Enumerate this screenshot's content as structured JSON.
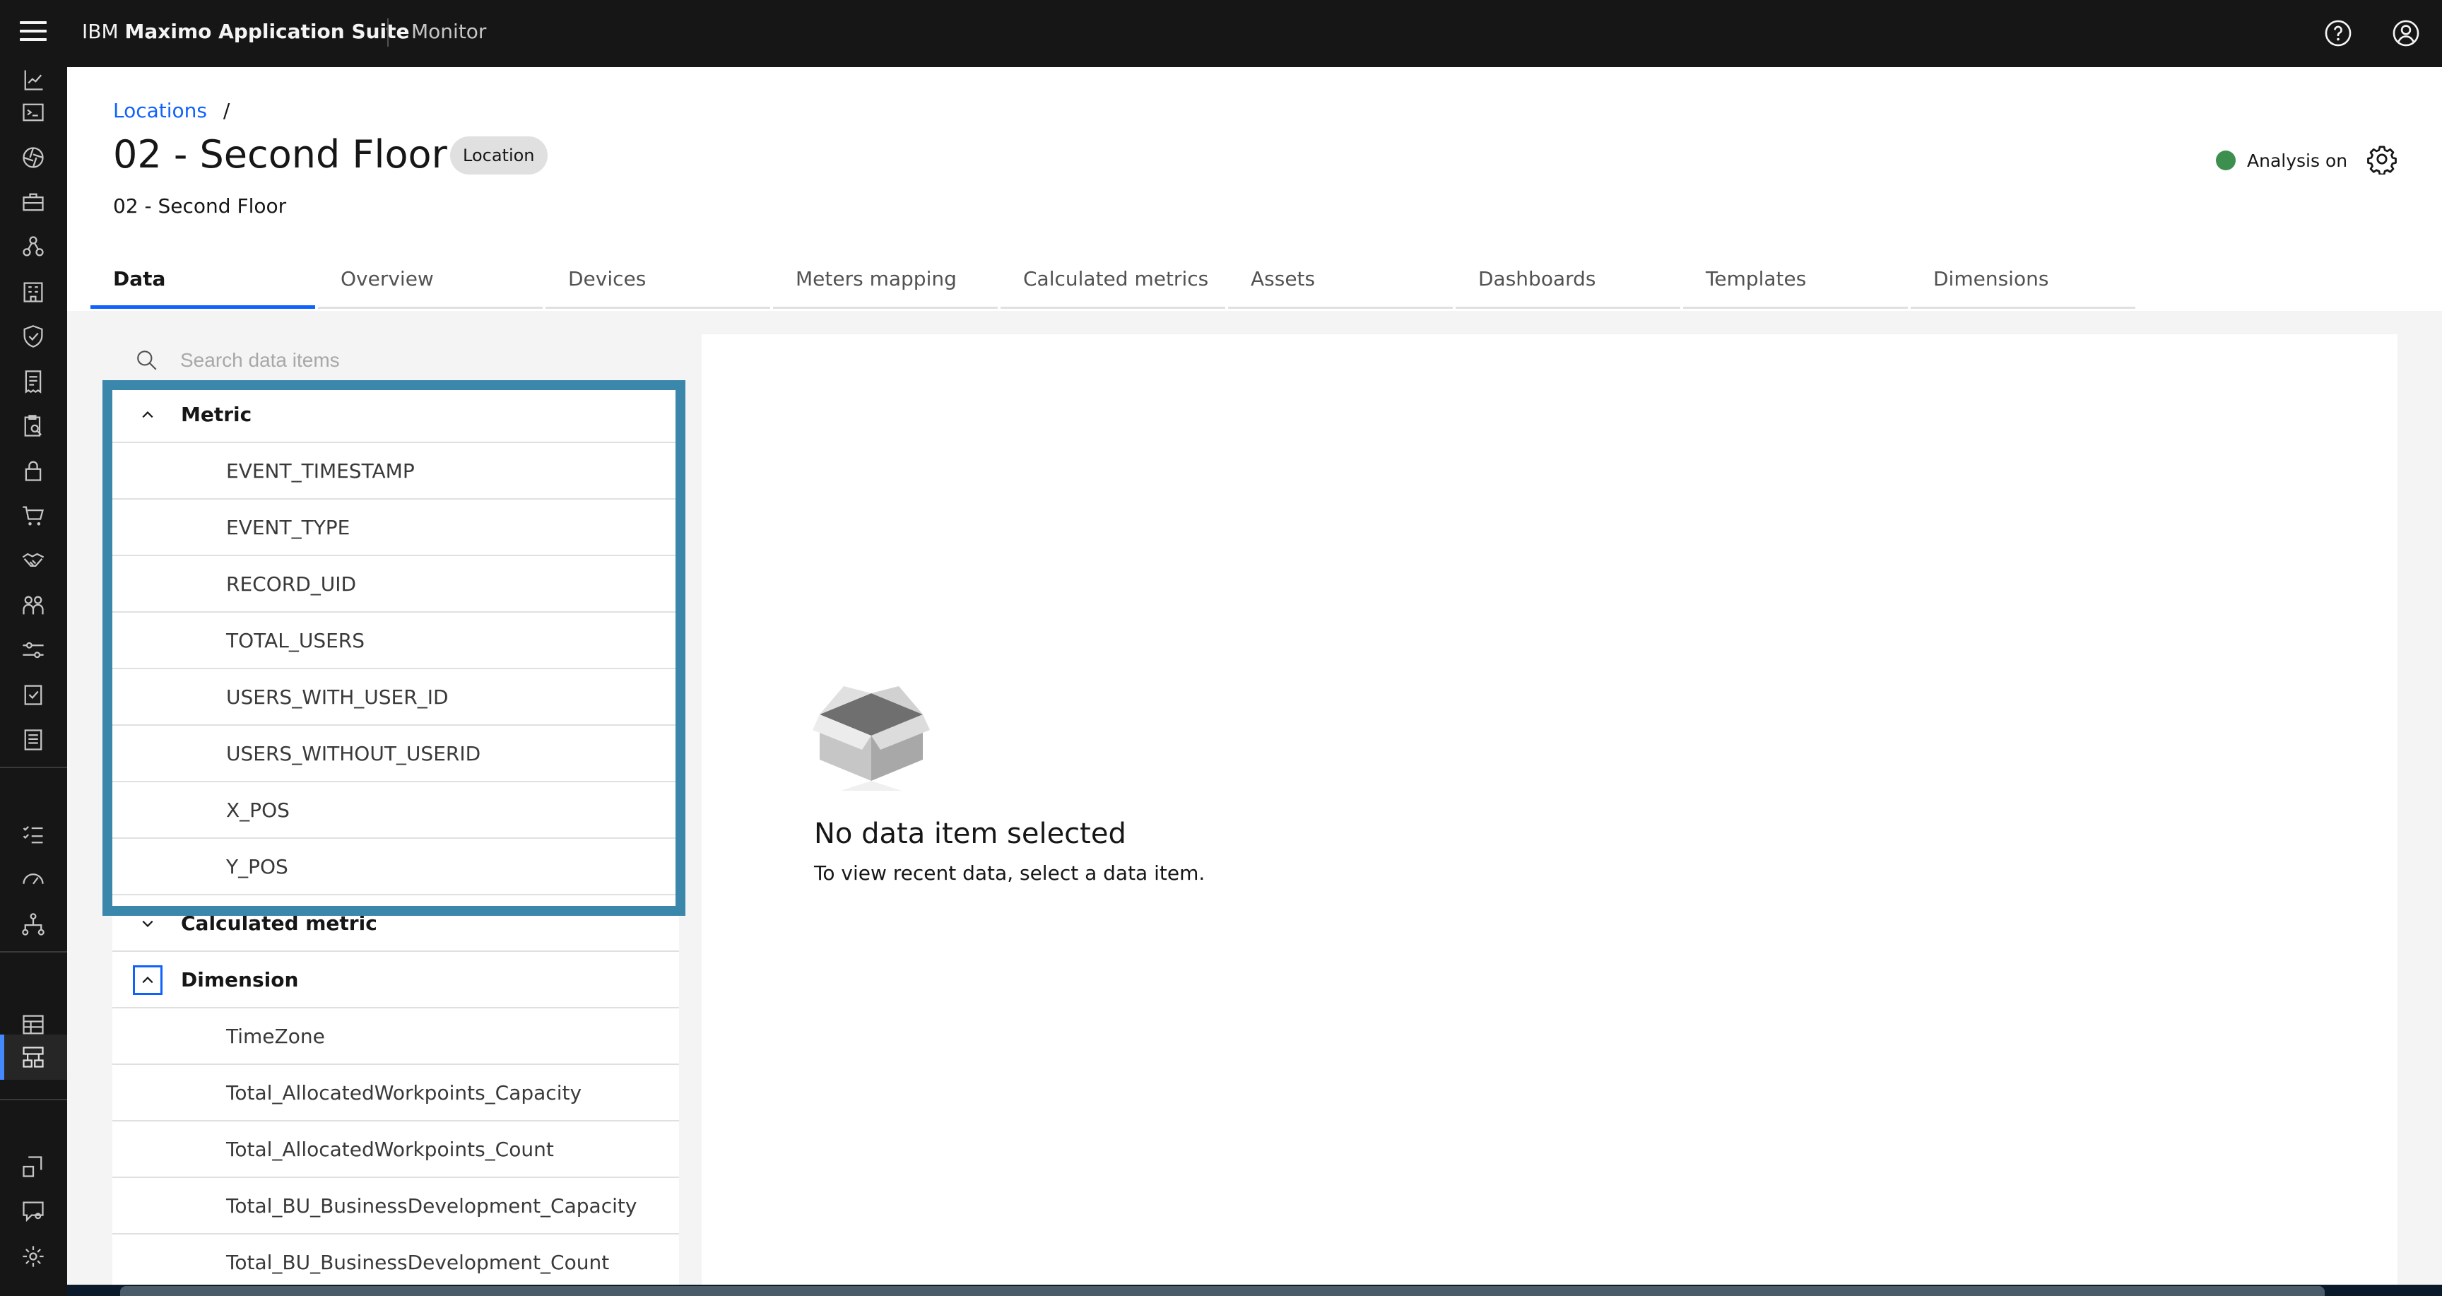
{
  "topbar": {
    "brand_prefix": "IBM",
    "brand_name": "Maximo Application Suite",
    "app_name": "Monitor",
    "help_icon": "help-icon",
    "user_icon": "user-avatar-icon"
  },
  "rail": {
    "icons": [
      "report-icon",
      "terminal-icon",
      "aperture-icon",
      "toolbox-icon",
      "hierarchy-icon",
      "building-icon",
      "shield-check-icon",
      "receipt-icon",
      "clipboard-search-icon",
      "lock-icon",
      "cart-icon",
      "handshake-icon",
      "people-icon",
      "sliders-icon",
      "checklist-icon",
      "document-list-icon",
      "task-list-icon",
      "gauge-icon",
      "network-icon",
      "table-icon",
      "data-structure-icon",
      "location-search-icon",
      "chat-settings-icon",
      "settings-icon"
    ]
  },
  "header": {
    "breadcrumb_link": "Locations",
    "breadcrumb_separator": "/",
    "title": "02 - Second Floor",
    "tag": "Location",
    "subtitle": "02 - Second Floor",
    "analysis_label": "Analysis on",
    "analysis_status_color": "#3d8f4f"
  },
  "tabs": [
    {
      "label": "Data",
      "selected": true
    },
    {
      "label": "Overview"
    },
    {
      "label": "Devices"
    },
    {
      "label": "Meters mapping"
    },
    {
      "label": "Calculated metrics"
    },
    {
      "label": "Assets"
    },
    {
      "label": "Dashboards"
    },
    {
      "label": "Templates"
    },
    {
      "label": "Dimensions"
    }
  ],
  "search": {
    "placeholder": "Search data items",
    "value": ""
  },
  "groups": {
    "metric": {
      "label": "Metric",
      "expanded": true,
      "items": [
        "EVENT_TIMESTAMP",
        "EVENT_TYPE",
        "RECORD_UID",
        "TOTAL_USERS",
        "USERS_WITH_USER_ID",
        "USERS_WITHOUT_USERID",
        "X_POS",
        "Y_POS"
      ]
    },
    "calculated_metric": {
      "label": "Calculated metric",
      "expanded": false
    },
    "dimension": {
      "label": "Dimension",
      "expanded": true,
      "items": [
        "TimeZone",
        "Total_AllocatedWorkpoints_Capacity",
        "Total_AllocatedWorkpoints_Count",
        "Total_BU_BusinessDevelopment_Capacity",
        "Total_BU_BusinessDevelopment_Count"
      ]
    }
  },
  "empty_state": {
    "title": "No data item selected",
    "description": "To view recent data, select a data item."
  },
  "colors": {
    "accent": "#0f62fe",
    "highlight_box": "#3b87ab",
    "topbar": "#161616"
  }
}
